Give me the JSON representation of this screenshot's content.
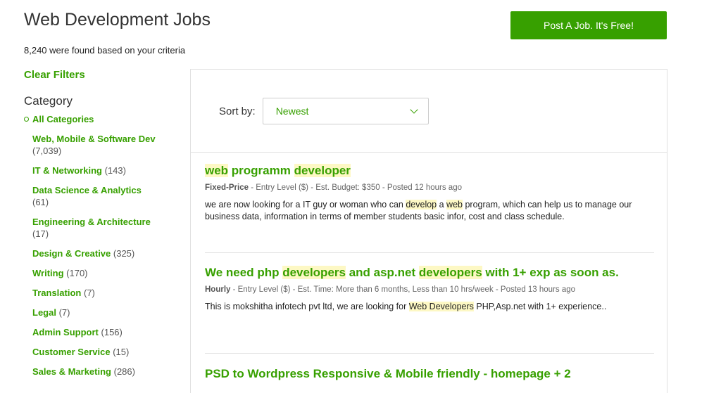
{
  "header": {
    "title": "Web Development Jobs",
    "result_count": "8,240 were found based on your criteria",
    "post_job_label": "Post A Job. It's Free!"
  },
  "sidebar": {
    "clear_filters": "Clear Filters",
    "category_heading": "Category",
    "all_categories": "All Categories",
    "categories": [
      {
        "name": "Web, Mobile & Software Dev",
        "count": "(7,039)"
      },
      {
        "name": "IT & Networking",
        "count": "(143)"
      },
      {
        "name": "Data Science & Analytics",
        "count": "(61)"
      },
      {
        "name": "Engineering & Architecture",
        "count": "(17)"
      },
      {
        "name": "Design & Creative",
        "count": "(325)"
      },
      {
        "name": "Writing",
        "count": "(170)"
      },
      {
        "name": "Translation",
        "count": "(7)"
      },
      {
        "name": "Legal",
        "count": "(7)"
      },
      {
        "name": "Admin Support",
        "count": "(156)"
      },
      {
        "name": "Customer Service",
        "count": "(15)"
      },
      {
        "name": "Sales & Marketing",
        "count": "(286)"
      }
    ]
  },
  "sort": {
    "label": "Sort by:",
    "value": "Newest",
    "icon": "chevron-down-icon"
  },
  "jobs": [
    {
      "title_parts": [
        {
          "text": "web",
          "hl": true
        },
        {
          "text": " programm ",
          "hl": false
        },
        {
          "text": "developer",
          "hl": true
        }
      ],
      "type": "Fixed-Price",
      "meta": " - Entry Level ($) - Est. Budget: $350 - Posted 12 hours ago",
      "desc_parts": [
        {
          "text": "we are now looking for a IT guy or woman who can ",
          "hl": false
        },
        {
          "text": "develop",
          "hl": true
        },
        {
          "text": " a ",
          "hl": false
        },
        {
          "text": "web",
          "hl": true
        },
        {
          "text": " program, which can help us to manage our business data, information in terms of member students basic infor, cost and class schedule.",
          "hl": false
        }
      ]
    },
    {
      "title_parts": [
        {
          "text": "We need php ",
          "hl": false
        },
        {
          "text": "developers",
          "hl": true
        },
        {
          "text": " and asp.net ",
          "hl": false
        },
        {
          "text": "developers",
          "hl": true
        },
        {
          "text": " with 1+ exp as soon as.",
          "hl": false
        }
      ],
      "type": "Hourly",
      "meta": " - Entry Level ($) - Est. Time: More than 6 months, Less than 10 hrs/week - Posted 13 hours ago",
      "desc_parts": [
        {
          "text": "This is mokshitha infotech pvt ltd, we are looking for ",
          "hl": false
        },
        {
          "text": "Web Developers",
          "hl": true
        },
        {
          "text": " PHP,Asp.net with 1+ experience..",
          "hl": false
        }
      ]
    },
    {
      "title_parts": [
        {
          "text": "PSD to Wordpress Responsive & Mobile friendly - homepage + 2",
          "hl": false
        }
      ],
      "type": "",
      "meta": "",
      "desc_parts": []
    }
  ],
  "colors": {
    "accent": "#37a000",
    "highlight": "#fdf8c4"
  }
}
